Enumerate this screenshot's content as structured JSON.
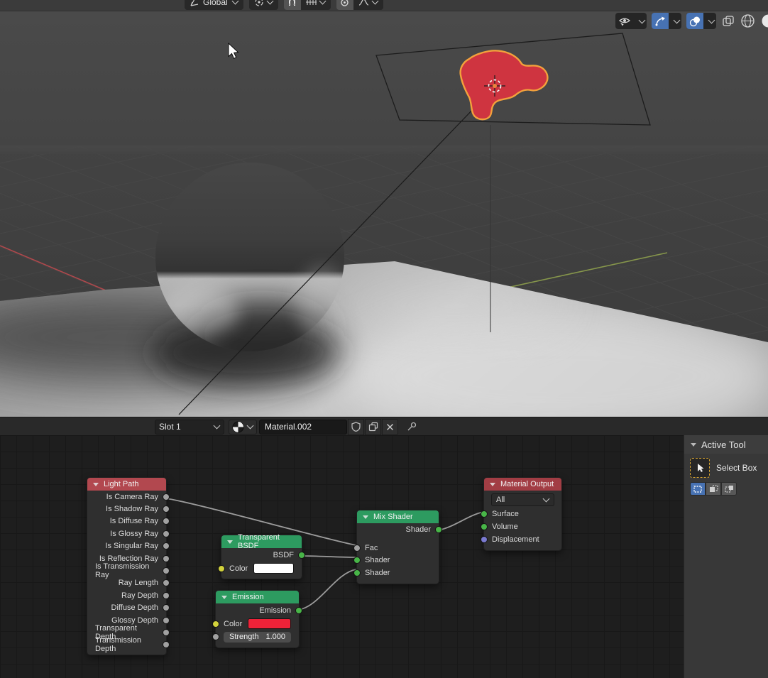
{
  "viewport": {
    "orientation": "Global"
  },
  "material_bar": {
    "slot": "Slot 1",
    "name": "Material.002"
  },
  "tool_panel": {
    "title": "Active Tool",
    "tool_name": "Select Box"
  },
  "nodes": {
    "light_path": {
      "title": "Light Path",
      "outputs": [
        "Is Camera Ray",
        "Is Shadow Ray",
        "Is Diffuse Ray",
        "Is Glossy Ray",
        "Is Singular Ray",
        "Is Reflection Ray",
        "Is Transmission Ray",
        "Ray Length",
        "Ray Depth",
        "Diffuse Depth",
        "Glossy Depth",
        "Transparent Depth",
        "Transmission Depth"
      ]
    },
    "transparent": {
      "title": "Transparent BSDF",
      "output": "BSDF",
      "color_label": "Color"
    },
    "emission": {
      "title": "Emission",
      "output": "Emission",
      "color_label": "Color",
      "strength_label": "Strength",
      "strength_value": "1.000"
    },
    "mix": {
      "title": "Mix Shader",
      "output": "Shader",
      "input_fac": "Fac",
      "input_shader1": "Shader",
      "input_shader2": "Shader"
    },
    "output": {
      "title": "Material Output",
      "target": "All",
      "input_surface": "Surface",
      "input_volume": "Volume",
      "input_displacement": "Displacement"
    }
  },
  "colors": {
    "header_input_node": "#b2484f",
    "header_shader_node": "#2d9b60",
    "header_output_node": "#a23d44",
    "socket_shader": "#48b548",
    "socket_value": "#a1a1a1",
    "socket_color": "#d2d23c",
    "socket_vector": "#7a7ad0",
    "emission_swatch_red": "#ee2238",
    "transparent_swatch_white": "#ffffff",
    "blob_red": "#cf3440",
    "selection_orange": "#f2a13c",
    "active_blue": "#4772b3"
  }
}
